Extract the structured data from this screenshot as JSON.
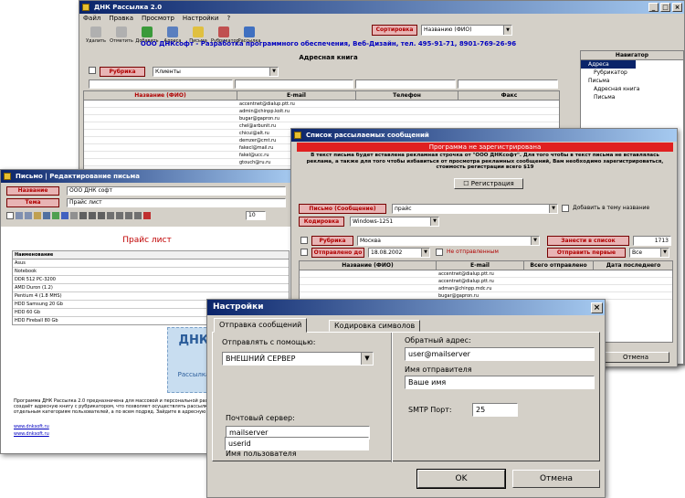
{
  "main": {
    "title": "ДНК Рассылка 2.0",
    "menu": [
      "Файл",
      "Правка",
      "Просмотр",
      "Настройки",
      "?"
    ],
    "toolbar": [
      "Удалить",
      "Отметить",
      "Добавить",
      "Адреса",
      "Письма",
      "Рубрикатор",
      "Рассылка"
    ],
    "sort_button": "Сортировка",
    "sort_value": "Названию (ФИО)",
    "banner": "ООО ДНКсофт - Разработка программного обеспечения, Веб-Дизайн, тел. 495-91-71, 8901-769-26-96",
    "grid_title": "Адресная книга",
    "rubric_button": "Рубрика",
    "rubric_value": "Клиенты",
    "columns": [
      "Название (ФИО)",
      "E-mail",
      "Телефон",
      "Факс"
    ],
    "emails": [
      "accentnet@dialup.ptt.ru",
      "admin@chinpp.kolt.ru",
      "bugar@gapron.ru",
      "chel@arbunit.ru",
      "chicui@alt.ru",
      "demzer@cmt.ru",
      "fakecl@mail.ru",
      "fakel@ucc.ru",
      "gtouch@ru.ru"
    ],
    "nav_title": "Навигатор",
    "nav_items": [
      "Адреса",
      "Рубрикатор",
      "Письма",
      "Адресная книга",
      "Письма"
    ]
  },
  "letter": {
    "title": "Письмо | Редактирование письма",
    "subject_button": "Название",
    "subject_value": "ООО ДНК софт",
    "topic_button": "Тема",
    "topic_value": "Прайс лист",
    "font_size": "10",
    "heading": "Прайс лист",
    "table_header": "Наименование",
    "rows": [
      "Asus",
      "Notebook",
      "DDR 512 PC-3200",
      "AMD Duron (1.2)",
      "Pentium 4 (1.8 MHS)",
      "HDD Samsung 20 Gb",
      "HDD 60 Gb",
      "HDD Fireball 80 Gb"
    ],
    "logo_text": "ДНК",
    "logo_sub": "Рассылка",
    "footer": "Программа ДНК Рассылка 2.0 предназначена для массовой и персональной рассылки писем. Пользователь сам создаёт адресную книгу с рубрикатором, что позволяет осуществлять рассылку как по всей базе, так и по отдельным категориям пользователей, а по всем подряд. Зайдите в адресную книгу...",
    "link": "www.dnksoft.ru",
    "link2": "www.dnksoft.ru"
  },
  "mailing": {
    "title": "Список рассылаемых сообщений",
    "trial_title": "Программа не зарегистрирована",
    "trial_text": "В текст письма будет вставлена рекламная строчка от \"ООО ДНКсофт\". Для того чтобы в текст письма не вставлялась реклама, а также для того чтобы избавиться от просмотра рекламных сообщений, Вам необходимо зарегистрироваться, стоимость регистрации всего $19",
    "register_button": "Регистрация",
    "letter_button": "Письмо (Сообщение)",
    "letter_value": "прайс",
    "add_label": "Добавить в тему название",
    "encoding_button": "Кодировка",
    "encoding_value": "Windows-1251",
    "rubric_button": "Рубрика",
    "rubric_value": "Москва",
    "sent_button": "Отправлено до",
    "sent_date": "18.08.2002",
    "not_sent_label": "Не отправленным",
    "add_list_button": "Занести в список",
    "count": "1713",
    "send_first_button": "Отправить первые",
    "send_first_value": "Все",
    "columns": [
      "Название (ФИО)",
      "E-mail",
      "Всего отправлено",
      "Дата последнего"
    ],
    "emails": [
      "accentnet@dialup.ptt.ru",
      "accentnet@dialup.ptt.ru",
      "adman@chinpp.mdc.ru",
      "bugar@gapron.ru"
    ],
    "cancel_button": "Отмена"
  },
  "settings": {
    "title": "Настройки",
    "tabs": [
      "Отправка сообщений",
      "Кодировка символов"
    ],
    "send_via_label": "Отправлять с помощью:",
    "send_via_value": "ВНЕШНИЙ СЕРВЕР",
    "server_label": "Почтовый сервер:",
    "server_value": "mailserver",
    "user_label": "Имя пользователя",
    "user_value": "userid",
    "return_label": "Обратный адрес:",
    "return_value": "user@mailserver",
    "sender_label": "Имя отправителя",
    "sender_value": "Ваше имя",
    "port_label": "SMTP Порт:",
    "port_value": "25",
    "ok_button": "OK",
    "cancel_button": "Отмена"
  },
  "colors": {
    "title_start": "#0a246a",
    "title_end": "#a6caf0",
    "red_button": "#e8b4b4",
    "banner": "#0000c0",
    "trial_red": "#e02020"
  }
}
